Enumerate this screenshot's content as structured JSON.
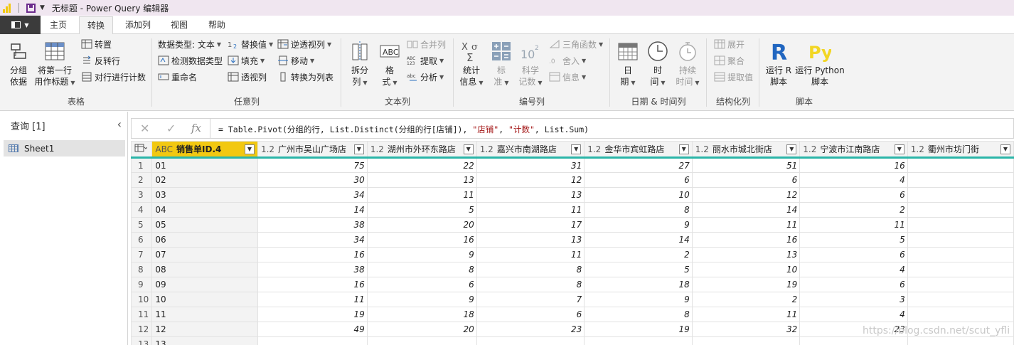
{
  "window": {
    "title": "无标题 - Power Query 编辑器"
  },
  "tabs": [
    "主页",
    "转换",
    "添加列",
    "视图",
    "帮助"
  ],
  "active_tab": "转换",
  "ribbon": {
    "table": {
      "group_label": "表格",
      "group_by": "分组\n依据",
      "use_first_row": "将第一行\n用作标题",
      "transpose": "转置",
      "reverse_rows": "反转行",
      "count_rows": "对行进行计数"
    },
    "any_column": {
      "group_label": "任意列",
      "data_type": "数据类型: 文本",
      "detect_type": "检测数据类型",
      "rename": "重命名",
      "replace_values": "替换值",
      "fill": "填充",
      "pivot": "透视列",
      "unpivot": "逆透视列",
      "move": "移动",
      "to_list": "转换为列表"
    },
    "text_column": {
      "group_label": "文本列",
      "split": "拆分\n列",
      "format": "格\n式",
      "merge": "合并列",
      "extract": "提取",
      "parse": "分析"
    },
    "number_column": {
      "group_label": "编号列",
      "stats": "统计\n信息",
      "standard": "标\n准",
      "scientific": "科学\n记数",
      "trig": "三角函数",
      "rounding": "舍入",
      "info": "信息"
    },
    "datetime_column": {
      "group_label": "日期 & 时间列",
      "date": "日\n期",
      "time": "时\n间",
      "duration": "持续\n时间"
    },
    "structured_column": {
      "group_label": "结构化列",
      "expand": "展开",
      "aggregate": "聚合",
      "extract_values": "提取值"
    },
    "scripts": {
      "group_label": "脚本",
      "run_r": "运行 R\n脚本",
      "run_python": "运行 Python\n脚本"
    }
  },
  "queries_pane": {
    "header": "查询 [1]",
    "items": [
      "Sheet1"
    ]
  },
  "formula_bar": {
    "prefix": "= Table.Pivot(分组的行, List.Distinct(分组的行[店铺]), ",
    "str1": "\"店铺\"",
    "mid": ", ",
    "str2": "\"计数\"",
    "suffix": ", List.Sum)"
  },
  "grid": {
    "id_column": {
      "type": "ABC",
      "name": "销售单ID.4"
    },
    "columns": [
      {
        "type": "1.2",
        "name": "广州市吴山广场店"
      },
      {
        "type": "1.2",
        "name": "湖州市外环东路店"
      },
      {
        "type": "1.2",
        "name": "嘉兴市南湖路店"
      },
      {
        "type": "1.2",
        "name": "金华市宾虹路店"
      },
      {
        "type": "1.2",
        "name": "丽水市城北街店"
      },
      {
        "type": "1.2",
        "name": "宁波市江南路店"
      },
      {
        "type": "1.2",
        "name": "衢州市坊门街"
      }
    ],
    "rows": [
      {
        "n": "1",
        "id": "01",
        "v": [
          "75",
          "22",
          "31",
          "27",
          "51",
          "16",
          ""
        ]
      },
      {
        "n": "2",
        "id": "02",
        "v": [
          "30",
          "13",
          "12",
          "6",
          "6",
          "4",
          ""
        ]
      },
      {
        "n": "3",
        "id": "03",
        "v": [
          "34",
          "11",
          "13",
          "10",
          "12",
          "6",
          ""
        ]
      },
      {
        "n": "4",
        "id": "04",
        "v": [
          "14",
          "5",
          "11",
          "8",
          "14",
          "2",
          ""
        ]
      },
      {
        "n": "5",
        "id": "05",
        "v": [
          "38",
          "20",
          "17",
          "9",
          "11",
          "11",
          ""
        ]
      },
      {
        "n": "6",
        "id": "06",
        "v": [
          "34",
          "16",
          "13",
          "14",
          "16",
          "5",
          ""
        ]
      },
      {
        "n": "7",
        "id": "07",
        "v": [
          "16",
          "9",
          "11",
          "2",
          "13",
          "6",
          ""
        ]
      },
      {
        "n": "8",
        "id": "08",
        "v": [
          "38",
          "8",
          "8",
          "5",
          "10",
          "4",
          ""
        ]
      },
      {
        "n": "9",
        "id": "09",
        "v": [
          "16",
          "6",
          "8",
          "18",
          "19",
          "6",
          ""
        ]
      },
      {
        "n": "10",
        "id": "10",
        "v": [
          "11",
          "9",
          "7",
          "9",
          "2",
          "3",
          ""
        ]
      },
      {
        "n": "11",
        "id": "11",
        "v": [
          "19",
          "18",
          "6",
          "8",
          "11",
          "4",
          ""
        ]
      },
      {
        "n": "12",
        "id": "12",
        "v": [
          "49",
          "20",
          "23",
          "19",
          "32",
          "23",
          ""
        ]
      },
      {
        "n": "13",
        "id": "13",
        "v": [
          "",
          "",
          "",
          "",
          "",
          "",
          ""
        ]
      }
    ]
  },
  "watermark": "https://blog.csdn.net/scut_yfli"
}
